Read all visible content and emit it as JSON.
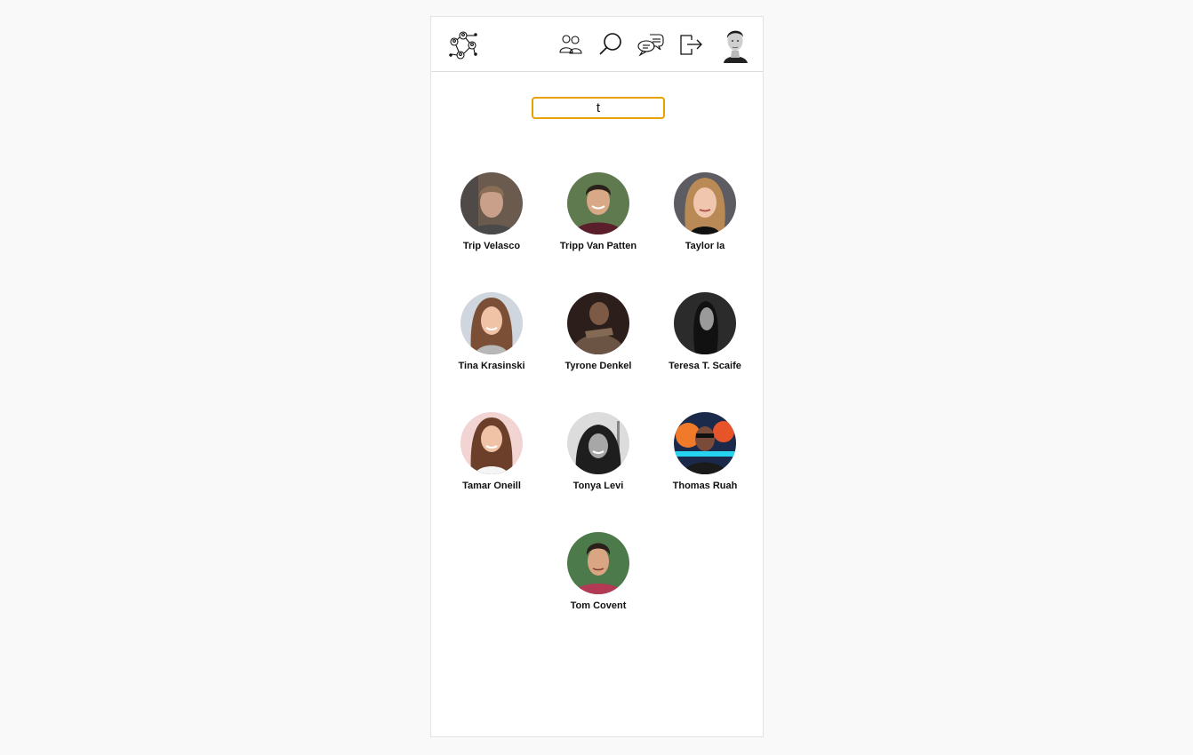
{
  "header": {
    "logo_icon": "people-network-icon",
    "nav": [
      {
        "icon": "friends-icon"
      },
      {
        "icon": "search-icon"
      },
      {
        "icon": "chat-icon"
      },
      {
        "icon": "logout-icon"
      }
    ],
    "profile_icon": "user-avatar"
  },
  "search": {
    "value": "t",
    "placeholder": ""
  },
  "colors": {
    "accent": "#e9a100",
    "border": "#dcdcdc",
    "page_bg": "#f9f9f9"
  },
  "people": [
    {
      "name": "Trip Velasco"
    },
    {
      "name": "Tripp Van Patten"
    },
    {
      "name": "Taylor Ia"
    },
    {
      "name": "Tina Krasinski"
    },
    {
      "name": "Tyrone Denkel"
    },
    {
      "name": "Teresa T. Scaife"
    },
    {
      "name": "Tamar Oneill"
    },
    {
      "name": "Tonya Levi"
    },
    {
      "name": "Thomas Ruah"
    },
    {
      "name": "Tom Covent"
    }
  ]
}
